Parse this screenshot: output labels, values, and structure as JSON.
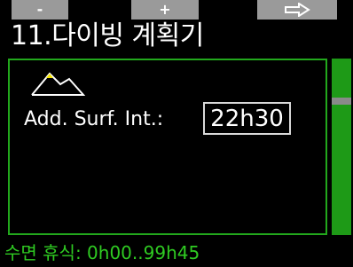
{
  "softkeys": {
    "left_label": "-",
    "center_label": "+",
    "right_icon": "arrow-right-outline-icon"
  },
  "title": "11.다이빙 계획기",
  "panel": {
    "icon": "mountain-altitude-icon",
    "field_label": "Add. Surf. Int.:",
    "field_value": "22h30"
  },
  "status_text": "수면 휴식: 0h00..99h45",
  "colors": {
    "accent_green": "#22a81c",
    "status_green": "#2fcb22",
    "softkey_gray": "#9a9a9a",
    "background": "#000000"
  }
}
